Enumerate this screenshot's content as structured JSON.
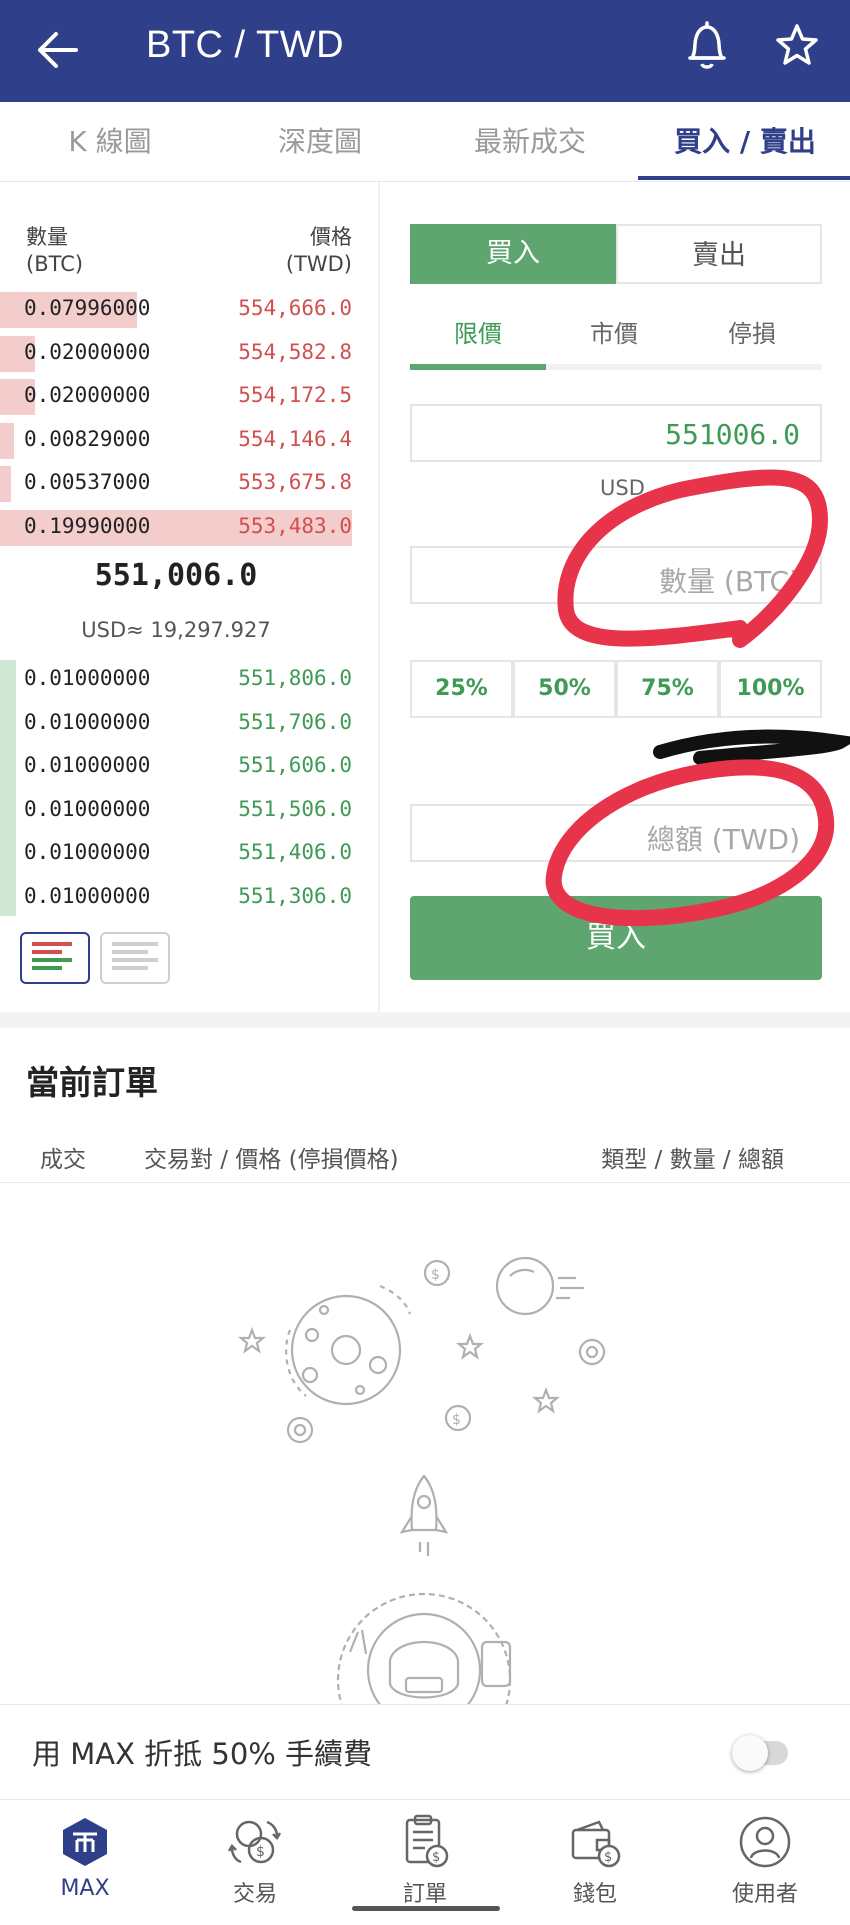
{
  "header": {
    "title": "BTC / TWD"
  },
  "tabs": [
    {
      "label": "K 線圖"
    },
    {
      "label": "深度圖"
    },
    {
      "label": "最新成交"
    },
    {
      "label": "買入 / 賣出"
    }
  ],
  "orderbook": {
    "qty_header": "數量",
    "qty_unit": "(BTC)",
    "price_header": "價格",
    "price_unit": "(TWD)",
    "asks": [
      {
        "qty": "0.07996000",
        "price": "554,666.0",
        "depth": 0.39
      },
      {
        "qty": "0.02000000",
        "price": "554,582.8",
        "depth": 0.1
      },
      {
        "qty": "0.02000000",
        "price": "554,172.5",
        "depth": 0.1
      },
      {
        "qty": "0.00829000",
        "price": "554,146.4",
        "depth": 0.04
      },
      {
        "qty": "0.00537000",
        "price": "553,675.8",
        "depth": 0.03
      },
      {
        "qty": "0.19990000",
        "price": "553,483.0",
        "depth": 1.0
      }
    ],
    "last_price": "551,006.0",
    "usd_ref": "USD≈ 19,297.927",
    "bids": [
      {
        "qty": "0.01000000",
        "price": "551,806.0"
      },
      {
        "qty": "0.01000000",
        "price": "551,706.0"
      },
      {
        "qty": "0.01000000",
        "price": "551,606.0"
      },
      {
        "qty": "0.01000000",
        "price": "551,506.0"
      },
      {
        "qty": "0.01000000",
        "price": "551,406.0"
      },
      {
        "qty": "0.01000000",
        "price": "551,306.0"
      }
    ]
  },
  "trade": {
    "buy_label": "買入",
    "sell_label": "賣出",
    "order_types": [
      "限價",
      "市價",
      "停損"
    ],
    "price_value": "551006.0",
    "usd_hint": "USD",
    "qty_placeholder": "數量 (BTC)",
    "pct_buttons": [
      "25%",
      "50%",
      "75%",
      "100%"
    ],
    "total_placeholder": "總額 (TWD)",
    "submit_label": "買入"
  },
  "orders": {
    "title": "當前訂單",
    "col_filled": "成交",
    "col_pair": "交易對 / 價格 (停損價格)",
    "col_type": "類型 / 數量 / 總額"
  },
  "fee": {
    "label": "用 MAX 折抵 50% 手續費",
    "enabled": false
  },
  "nav": [
    {
      "label": "MAX",
      "icon": "max-logo-icon",
      "active": true
    },
    {
      "label": "交易",
      "icon": "exchange-icon"
    },
    {
      "label": "訂單",
      "icon": "orders-icon"
    },
    {
      "label": "錢包",
      "icon": "wallet-icon"
    },
    {
      "label": "使用者",
      "icon": "user-icon"
    }
  ],
  "colors": {
    "brand": "#2f3f8a",
    "buy": "#5ea56f",
    "ask": "#d0504f",
    "annotation": "#e8344a"
  }
}
